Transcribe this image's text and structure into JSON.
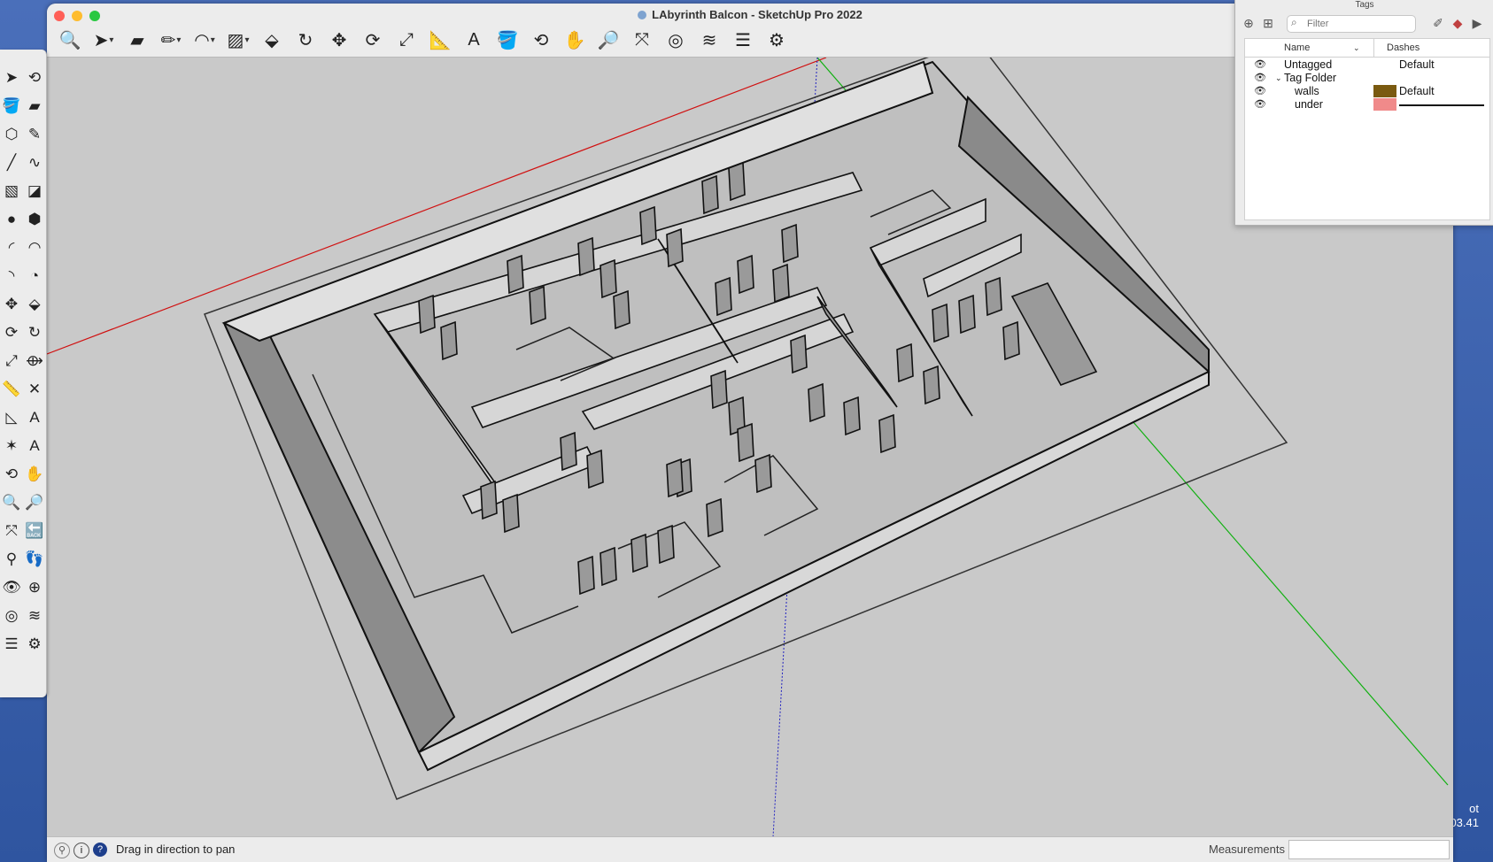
{
  "desktop": {
    "text_line1": "ot",
    "text_line2": ".03.41"
  },
  "window": {
    "title": "LAbyrinth Balcon - SketchUp Pro 2022",
    "toolbar": [
      {
        "name": "zoom-window-icon",
        "glyph": "🔍"
      },
      {
        "name": "select-icon",
        "glyph": "➤",
        "drop": true
      },
      {
        "name": "eraser-icon",
        "glyph": "▰"
      },
      {
        "name": "line-icon",
        "glyph": "✏",
        "drop": true
      },
      {
        "name": "arc-icon",
        "glyph": "◠",
        "drop": true
      },
      {
        "name": "rectangle-icon",
        "glyph": "▨",
        "drop": true
      },
      {
        "name": "push-pull-icon",
        "glyph": "⬙"
      },
      {
        "name": "follow-me-icon",
        "glyph": "↻"
      },
      {
        "name": "move-icon",
        "glyph": "✥"
      },
      {
        "name": "rotate-icon",
        "glyph": "⟳"
      },
      {
        "name": "scale-icon",
        "glyph": "⤢"
      },
      {
        "name": "tape-measure-icon",
        "glyph": "📐"
      },
      {
        "name": "text-icon",
        "glyph": "A"
      },
      {
        "name": "paint-bucket-icon",
        "glyph": "🪣"
      },
      {
        "name": "orbit-icon",
        "glyph": "⟲"
      },
      {
        "name": "pan-icon",
        "glyph": "✋"
      },
      {
        "name": "zoom-icon",
        "glyph": "🔎"
      },
      {
        "name": "zoom-extents-icon",
        "glyph": "⤧"
      },
      {
        "name": "3d-warehouse-icon",
        "glyph": "◎"
      },
      {
        "name": "extension-warehouse-icon",
        "glyph": "≋"
      },
      {
        "name": "layout-icon",
        "glyph": "☰"
      },
      {
        "name": "extension-manager-icon",
        "glyph": "⚙"
      }
    ]
  },
  "palette": {
    "tools": [
      {
        "name": "select-icon",
        "glyph": "➤"
      },
      {
        "name": "lasso-icon",
        "glyph": "⟲"
      },
      {
        "name": "paint-bucket-icon",
        "glyph": "🪣"
      },
      {
        "name": "eraser-icon",
        "glyph": "▰"
      },
      {
        "name": "components-icon",
        "glyph": "⬡"
      },
      {
        "name": "pencil-icon",
        "glyph": "✎"
      },
      {
        "name": "line-icon",
        "glyph": "╱"
      },
      {
        "name": "freehand-icon",
        "glyph": "∿"
      },
      {
        "name": "rectangle-icon",
        "glyph": "▧"
      },
      {
        "name": "rotated-rectangle-icon",
        "glyph": "◪"
      },
      {
        "name": "circle-icon",
        "glyph": "●"
      },
      {
        "name": "polygon-icon",
        "glyph": "⬢"
      },
      {
        "name": "arc-icon",
        "glyph": "◜"
      },
      {
        "name": "two-point-arc-icon",
        "glyph": "◠"
      },
      {
        "name": "three-point-arc-icon",
        "glyph": "◝"
      },
      {
        "name": "pie-icon",
        "glyph": "◔"
      },
      {
        "name": "move-icon",
        "glyph": "✥"
      },
      {
        "name": "push-pull-icon",
        "glyph": "⬙"
      },
      {
        "name": "rotate-icon",
        "glyph": "⟳"
      },
      {
        "name": "follow-me-icon",
        "glyph": "↻"
      },
      {
        "name": "scale-icon",
        "glyph": "⤢"
      },
      {
        "name": "offset-icon",
        "glyph": "⟴"
      },
      {
        "name": "tape-measure-icon",
        "glyph": "📏"
      },
      {
        "name": "dimension-icon",
        "glyph": "✕"
      },
      {
        "name": "protractor-icon",
        "glyph": "◺"
      },
      {
        "name": "text-icon",
        "glyph": "A"
      },
      {
        "name": "axes-icon",
        "glyph": "✶"
      },
      {
        "name": "3d-text-icon",
        "glyph": "A"
      },
      {
        "name": "orbit-icon",
        "glyph": "⟲"
      },
      {
        "name": "pan-icon",
        "glyph": "✋"
      },
      {
        "name": "zoom-icon",
        "glyph": "🔍"
      },
      {
        "name": "zoom-window-icon",
        "glyph": "🔎"
      },
      {
        "name": "zoom-extents-icon",
        "glyph": "⤧"
      },
      {
        "name": "previous-view-icon",
        "glyph": "🔙"
      },
      {
        "name": "position-camera-icon",
        "glyph": "⚲"
      },
      {
        "name": "walk-icon",
        "glyph": "👣"
      },
      {
        "name": "look-around-icon",
        "glyph": "👁"
      },
      {
        "name": "section-plane-icon",
        "glyph": "⊕"
      },
      {
        "name": "3d-warehouse-icon",
        "glyph": "◎"
      },
      {
        "name": "extension-warehouse-icon",
        "glyph": "≋"
      },
      {
        "name": "layout-icon",
        "glyph": "☰"
      },
      {
        "name": "extension-manager-icon",
        "glyph": "⚙"
      }
    ]
  },
  "status": {
    "message": "Drag in direction to pan",
    "measurements_label": "Measurements",
    "measurements_value": ""
  },
  "tags_panel": {
    "title": "Tags",
    "filter_placeholder": "Filter",
    "col_name": "Name",
    "col_dashes": "Dashes",
    "rows": [
      {
        "name": "Untagged",
        "indent": false,
        "folder": false,
        "color": "",
        "dashes": "Default"
      },
      {
        "name": "Tag Folder",
        "indent": false,
        "folder": true,
        "color": "",
        "dashes": ""
      },
      {
        "name": "walls",
        "indent": true,
        "folder": false,
        "color": "#7a5a10",
        "dashes": "Default"
      },
      {
        "name": "under",
        "indent": true,
        "folder": false,
        "color": "#f08a8a",
        "dashes": ""
      }
    ]
  },
  "colors": {
    "red_axis": "#d01010",
    "green_axis": "#10b010",
    "blue_axis": "#2020c0"
  }
}
